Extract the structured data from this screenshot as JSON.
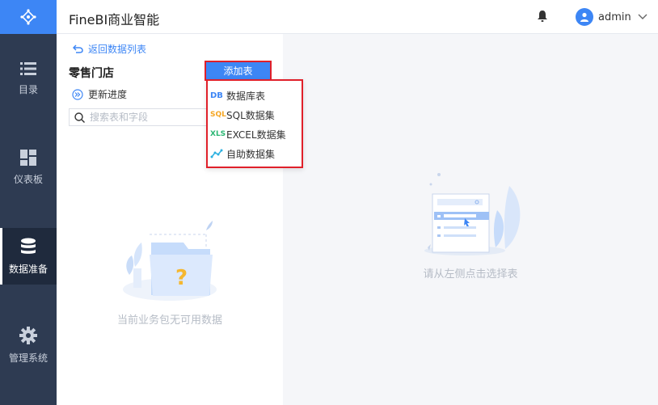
{
  "header": {
    "app_title": "FineBI商业智能",
    "user_name": "admin"
  },
  "sidebar": {
    "items": [
      {
        "label": "目录",
        "icon": "list-icon",
        "active": false
      },
      {
        "label": "仪表板",
        "icon": "dashboard-icon",
        "active": false
      },
      {
        "label": "数据准备",
        "icon": "database-icon",
        "active": true
      },
      {
        "label": "管理系统",
        "icon": "gear-icon",
        "active": false
      }
    ]
  },
  "left_panel": {
    "back_label": "返回数据列表",
    "package_title": "零售门店",
    "add_table_label": "添加表",
    "update_label": "更新进度",
    "search_placeholder": "搜索表和字段",
    "empty_text": "当前业务包无可用数据"
  },
  "dropdown": {
    "items": [
      {
        "label": "数据库表",
        "icon_text": "DB",
        "color": "#3d86f5"
      },
      {
        "label": "SQL数据集",
        "icon_text": "SQL",
        "color": "#f5a623"
      },
      {
        "label": "EXCEL数据集",
        "icon_text": "XLS",
        "color": "#2bb673"
      },
      {
        "label": "自助数据集",
        "icon_text": "",
        "color": "#2bb0e0"
      }
    ]
  },
  "right_panel": {
    "empty_text": "请从左侧点击选择表"
  },
  "colors": {
    "accent": "#3d86f5",
    "sidebar": "#2e3b52",
    "highlight": "#e0202a"
  }
}
